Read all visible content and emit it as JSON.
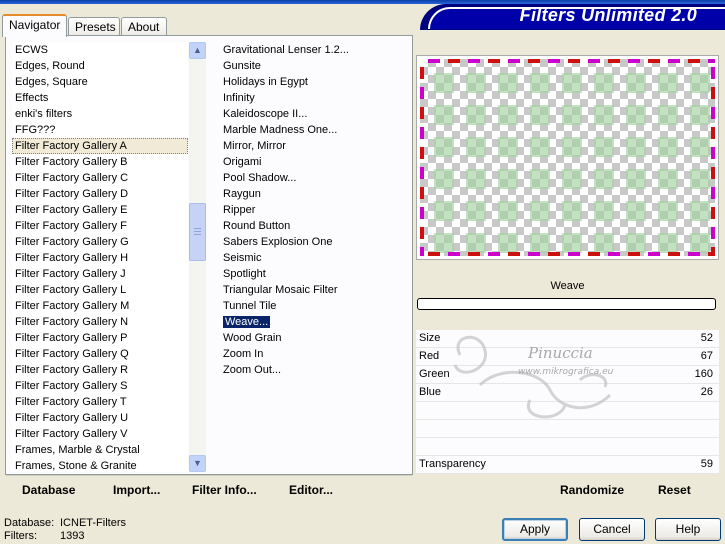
{
  "window": {
    "title": "Filters Unlimited 2.0"
  },
  "tabs": [
    {
      "label": "Navigator",
      "active": true
    },
    {
      "label": "Presets",
      "active": false
    },
    {
      "label": "About",
      "active": false
    }
  ],
  "categories": [
    "ECWS",
    "Edges, Round",
    "Edges, Square",
    "Effects",
    "enki's filters",
    "FFG???",
    "Filter Factory Gallery A",
    "Filter Factory Gallery B",
    "Filter Factory Gallery C",
    "Filter Factory Gallery D",
    "Filter Factory Gallery E",
    "Filter Factory Gallery F",
    "Filter Factory Gallery G",
    "Filter Factory Gallery H",
    "Filter Factory Gallery J",
    "Filter Factory Gallery L",
    "Filter Factory Gallery M",
    "Filter Factory Gallery N",
    "Filter Factory Gallery P",
    "Filter Factory Gallery Q",
    "Filter Factory Gallery R",
    "Filter Factory Gallery S",
    "Filter Factory Gallery T",
    "Filter Factory Gallery U",
    "Filter Factory Gallery V",
    "Frames, Marble & Crystal",
    "Frames, Stone & Granite"
  ],
  "selected_category": "Filter Factory Gallery A",
  "filters": [
    "Gravitational Lenser 1.2...",
    "Gunsite",
    "Holidays in Egypt",
    "Infinity",
    "Kaleidoscope II...",
    "Marble Madness One...",
    "Mirror, Mirror",
    "Origami",
    "Pool Shadow...",
    "Raygun",
    "Ripper",
    "Round Button",
    "Sabers Explosion One",
    "Seismic",
    "Spotlight",
    "Triangular Mosaic Filter",
    "Tunnel Tile",
    "Weave...",
    "Wood Grain",
    "Zoom In",
    "Zoom Out..."
  ],
  "selected_filter": "Weave...",
  "scrollbar": {
    "up_icon": "chevron-up-icon",
    "down_icon": "chevron-down-icon"
  },
  "bottom_left": {
    "database": "Database",
    "import": "Import...",
    "filter_info": "Filter Info...",
    "editor": "Editor..."
  },
  "preview": {
    "filter_name": "Weave",
    "progress": 0
  },
  "params": [
    {
      "label": "Size",
      "value": "52"
    },
    {
      "label": "Red",
      "value": "67"
    },
    {
      "label": "Green",
      "value": "160"
    },
    {
      "label": "Blue",
      "value": "26"
    },
    {
      "label": "",
      "value": ""
    },
    {
      "label": "",
      "value": ""
    },
    {
      "label": "",
      "value": ""
    },
    {
      "label": "Transparency",
      "value": "59"
    }
  ],
  "watermark": {
    "name": "Pinuccia",
    "site": "www.mikrografica.eu"
  },
  "bottom_right": {
    "randomize": "Randomize",
    "reset": "Reset"
  },
  "buttons": {
    "apply": "Apply",
    "cancel": "Cancel",
    "help": "Help"
  },
  "status": {
    "database_label": "Database:",
    "database_value": "ICNET-Filters",
    "filters_label": "Filters:",
    "filters_value": "1393"
  },
  "colors": {
    "banner": "#0000a8",
    "selection": "#0a246a",
    "weave_edge_red": "#cc1010",
    "weave_edge_magenta": "#cc00cc",
    "weave_green": "#a3d2a0"
  }
}
